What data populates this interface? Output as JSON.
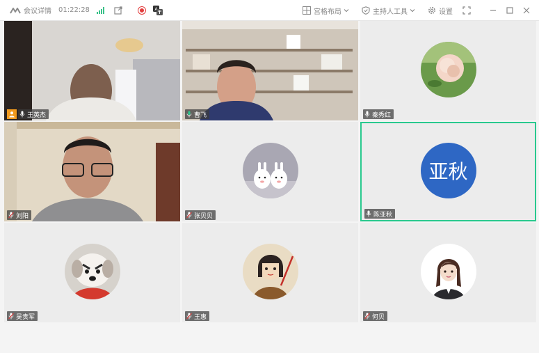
{
  "app": {
    "meeting_details_label": "会议详情",
    "timer": "01:22:28"
  },
  "toolbar": {
    "layout_label": "宫格布局",
    "host_tools_label": "主持人工具",
    "settings_label": "设置"
  },
  "colors": {
    "accent_green": "#29c98e",
    "record_red": "#e23b3b",
    "host_orange": "#f19a1e",
    "avatar_blue": "#2e67c4"
  },
  "participants": [
    {
      "name": "王英杰",
      "type": "video",
      "host": true
    },
    {
      "name": "曹飞",
      "type": "video",
      "host": false
    },
    {
      "name": "秦秀红",
      "type": "avatar-image",
      "avatar": "rose-photo"
    },
    {
      "name": "刘阳",
      "type": "video",
      "host": false
    },
    {
      "name": "张贝贝",
      "type": "avatar-image",
      "avatar": "bunnies-photo"
    },
    {
      "name": "陈亚秋",
      "type": "avatar-text",
      "avatar_text": "亚秋",
      "active": true
    },
    {
      "name": "吴贵军",
      "type": "avatar-image",
      "avatar": "dog-photo"
    },
    {
      "name": "王惠",
      "type": "avatar-image",
      "avatar": "cartoon-girl-photo"
    },
    {
      "name": "何贝",
      "type": "avatar-image",
      "avatar": "cartoon-woman-photo"
    }
  ]
}
